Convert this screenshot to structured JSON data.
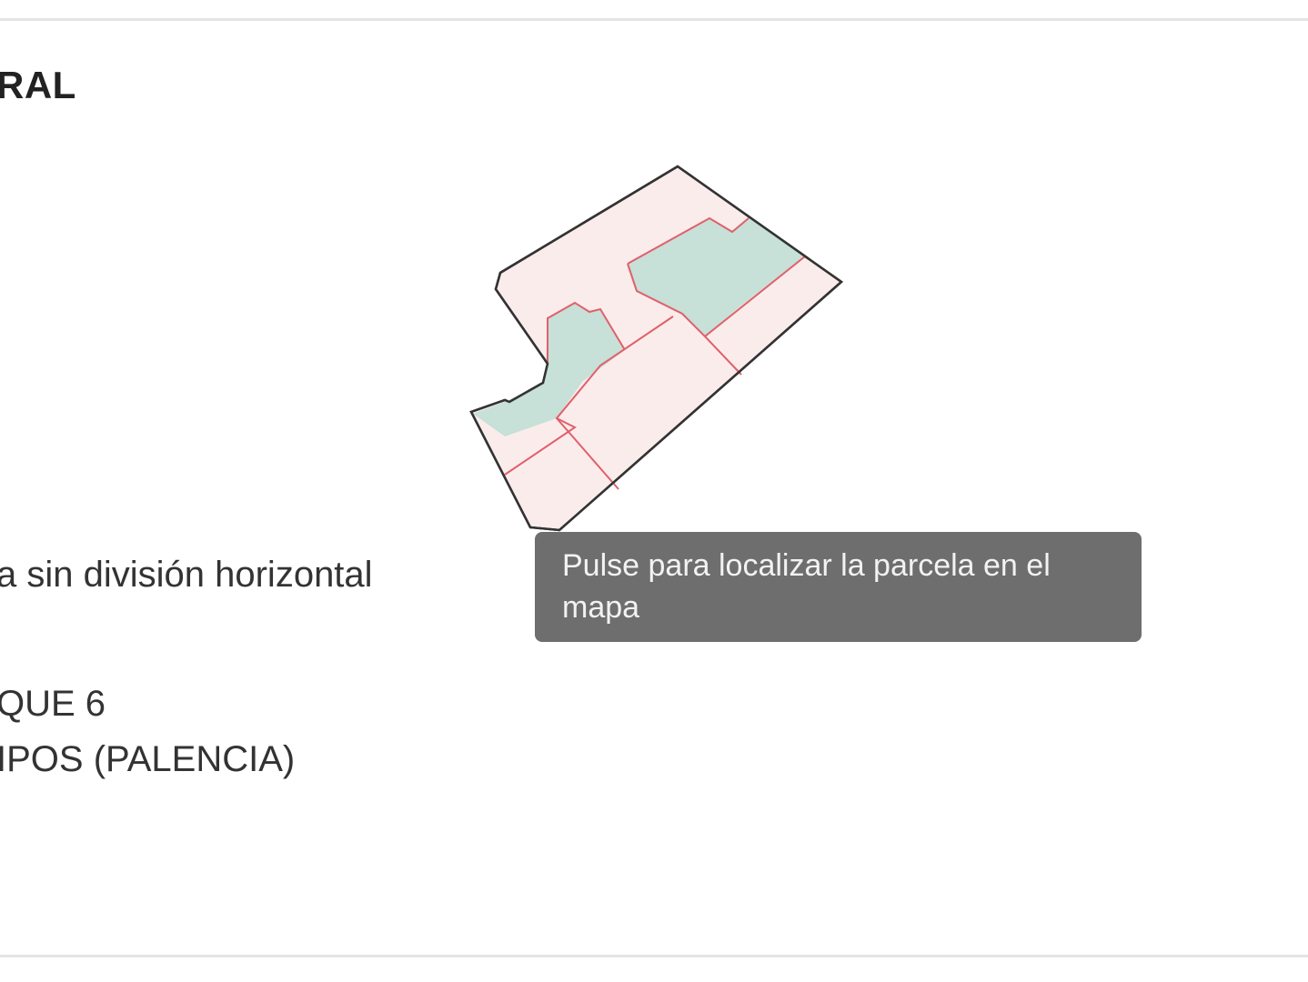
{
  "section": {
    "title": "RAL"
  },
  "details": {
    "use_line": "a sin división horizontal",
    "address_line_1": "QUE 6",
    "address_line_2": "IPOS (PALENCIA)"
  },
  "map": {
    "icon": "parcel-map-icon",
    "colors": {
      "outline": "#333333",
      "parcel_fill": "#fbecec",
      "subparcel_border": "#e0606a",
      "building_fill": "#c7e0d8"
    }
  },
  "tooltip": {
    "text": "Pulse para localizar la parcela en el mapa"
  }
}
